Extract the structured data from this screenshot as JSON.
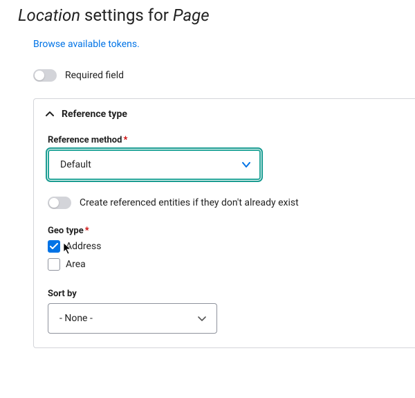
{
  "page_title": {
    "prefix_italic": "Location",
    "middle": " settings for ",
    "suffix_italic": "Page"
  },
  "browse_tokens_link": "Browse available tokens.",
  "required_field": {
    "label": "Required field",
    "value": false
  },
  "reference_type": {
    "summary": "Reference type",
    "expanded": true,
    "reference_method": {
      "label": "Reference method",
      "required": true,
      "value": "Default"
    },
    "create_entities": {
      "label": "Create referenced entities if they don't already exist",
      "value": false
    },
    "geo_type": {
      "label": "Geo type",
      "required": true,
      "options": [
        {
          "label": "Address",
          "checked": true
        },
        {
          "label": "Area",
          "checked": false
        }
      ]
    },
    "sort_by": {
      "label": "Sort by",
      "value": "- None -"
    }
  }
}
